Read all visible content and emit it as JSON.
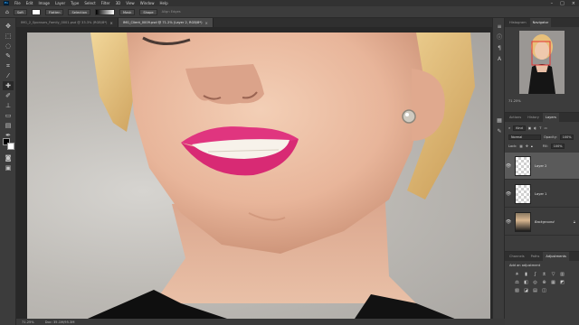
{
  "menubar": {
    "logo": "Ps",
    "items": [
      "File",
      "Edit",
      "Image",
      "Layer",
      "Type",
      "Select",
      "Filter",
      "3D",
      "View",
      "Window",
      "Help"
    ]
  },
  "options": {
    "fields": [
      "Soft",
      "Flatten",
      "Selection",
      "Mask",
      "Shape"
    ],
    "dim": "Align Edges"
  },
  "tabs": [
    {
      "label": "IMG_2_Sponsors_Family_0001.psd @ 33.3% (RGB/8*)",
      "active": false
    },
    {
      "label": "IMG_Client_0009.psd @ 71.2% (Layer 2, RGB/8*)",
      "active": true
    }
  ],
  "status": {
    "zoom": "71.25%",
    "doc": "Doc: 35.1M/95.3M"
  },
  "navigator": {
    "tabs": [
      "Histogram",
      "Navigator"
    ],
    "active_tab": "Navigator",
    "zoom": "71.25%"
  },
  "layers": {
    "tabs": [
      "Actions",
      "History",
      "Layers"
    ],
    "active_tab": "Layers",
    "kind": "Kind",
    "blend_mode": "Normal",
    "opacity_label": "Opacity:",
    "opacity": "100%",
    "lock_label": "Lock:",
    "fill_label": "Fill:",
    "fill": "100%",
    "items": [
      {
        "name": "Layer 2",
        "selected": true,
        "type": "empty"
      },
      {
        "name": "Layer 1",
        "selected": false,
        "type": "empty"
      },
      {
        "name": "Background",
        "selected": false,
        "type": "photo"
      }
    ]
  },
  "adjustments": {
    "tabs": [
      "Channels",
      "Paths",
      "Adjustments"
    ],
    "active_tab": "Adjustments",
    "title": "Add an adjustment",
    "icons": [
      "brightness-icon",
      "levels-icon",
      "curves-icon",
      "exposure-icon",
      "vibrance-icon",
      "hue-icon",
      "color-balance-icon",
      "bw-icon",
      "photo-filter-icon",
      "channel-mixer-icon",
      "lookup-icon",
      "invert-icon",
      "posterize-icon",
      "threshold-icon",
      "gradient-map-icon",
      "selective-color-icon"
    ]
  },
  "colors": {
    "app_bg": "#535353",
    "panel_bg": "#3c3c3c",
    "lips": "#e0357f",
    "skin": "#f0c8ae"
  }
}
